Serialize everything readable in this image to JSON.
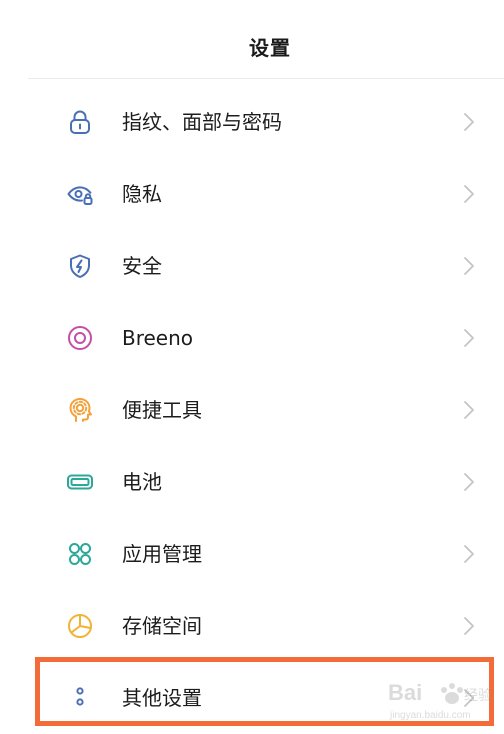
{
  "header": {
    "title": "设置"
  },
  "items": [
    {
      "label": "指纹、面部与密码",
      "icon": "lock-icon",
      "color": "#4a6fb5"
    },
    {
      "label": "隐私",
      "icon": "privacy-eye-lock-icon",
      "color": "#4a6fb5"
    },
    {
      "label": "安全",
      "icon": "shield-bolt-icon",
      "color": "#4a6fb5"
    },
    {
      "label": "Breeno",
      "icon": "breeno-ring-icon",
      "color": "#c24fa8"
    },
    {
      "label": "便捷工具",
      "icon": "head-gear-icon",
      "color": "#f2a23a"
    },
    {
      "label": "电池",
      "icon": "battery-icon",
      "color": "#2ba897"
    },
    {
      "label": "应用管理",
      "icon": "app-grid-icon",
      "color": "#2ba897"
    },
    {
      "label": "存储空间",
      "icon": "storage-pie-icon",
      "color": "#f2b233"
    },
    {
      "label": "其他设置",
      "icon": "more-dots-icon",
      "color": "#4a6fb5"
    }
  ],
  "colors": {
    "highlight": "#f26b38",
    "chevron": "#c4c4c4",
    "divider": "#ececec"
  },
  "watermark": {
    "brand": "Baidu",
    "url": "jingyan.baidu.com"
  }
}
